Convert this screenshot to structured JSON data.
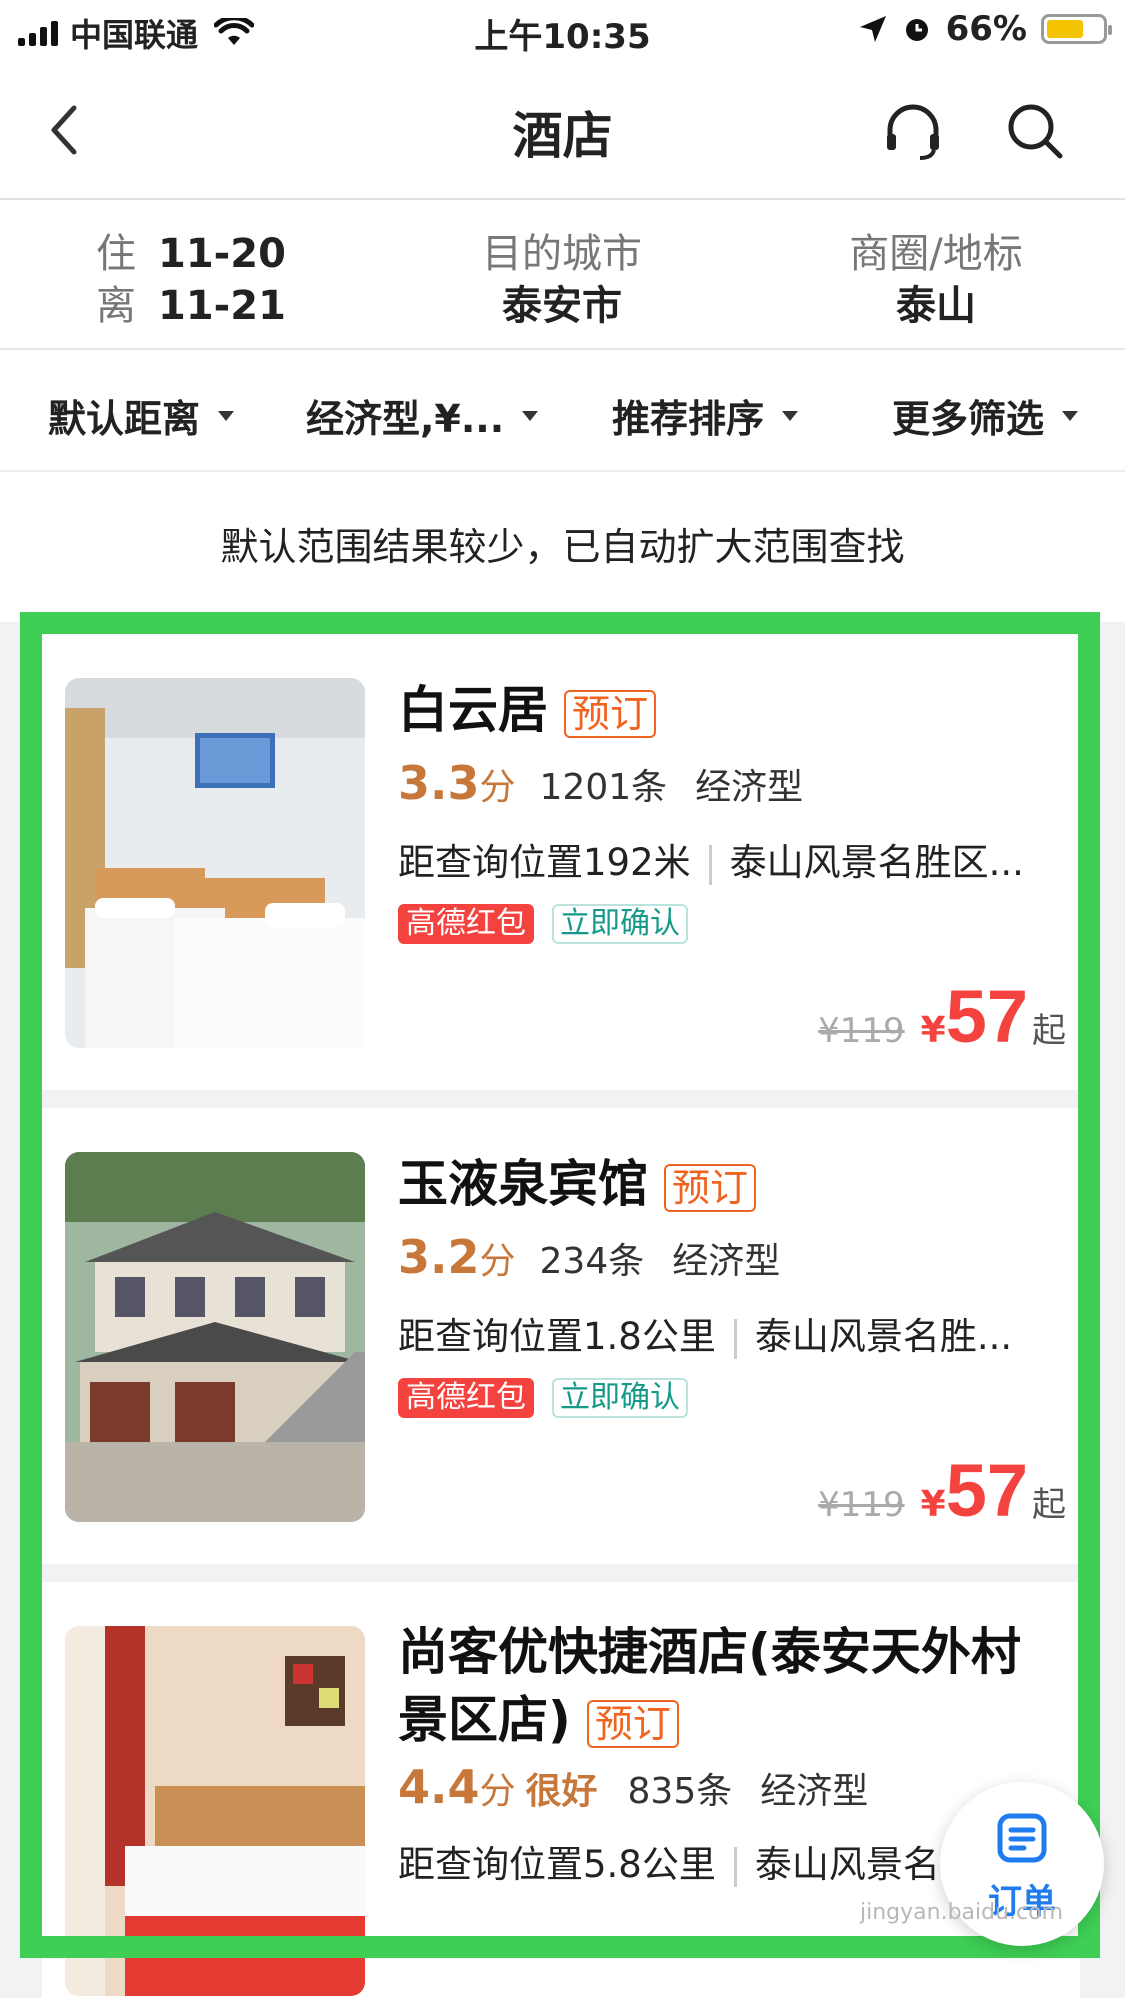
{
  "status_bar": {
    "carrier": "中国联通",
    "time": "上午10:35",
    "battery": "66%"
  },
  "nav": {
    "title": "酒店",
    "back_icon": "chevron-left-icon",
    "service_icon": "headset-icon",
    "search_icon": "search-icon"
  },
  "info": {
    "checkin_label": "住",
    "checkin_date": "11-20",
    "checkout_label": "离",
    "checkout_date": "11-21",
    "city_label": "目的城市",
    "city_value": "泰安市",
    "area_label": "商圈/地标",
    "area_value": "泰山"
  },
  "filters": [
    "默认距离",
    "经济型,¥...",
    "推荐排序",
    "更多筛选"
  ],
  "notice": "默认范围结果较少，已自动扩大范围查找",
  "hotels": [
    {
      "name": "白云居",
      "book_tag": "预订",
      "score": "3.3",
      "score_unit": "分",
      "reviews": "1201条",
      "category": "经济型",
      "distance": "距查询位置192米",
      "area": "泰山风景名胜区...",
      "tag1": "高德红包",
      "tag2": "立即确认",
      "orig_price": "¥119",
      "currency": "¥",
      "price": "57",
      "price_suffix": "起"
    },
    {
      "name": "玉液泉宾馆",
      "book_tag": "预订",
      "score": "3.2",
      "score_unit": "分",
      "reviews": "234条",
      "category": "经济型",
      "distance": "距查询位置1.8公里",
      "area": "泰山风景名胜...",
      "tag1": "高德红包",
      "tag2": "立即确认",
      "orig_price": "¥119",
      "currency": "¥",
      "price": "57",
      "price_suffix": "起"
    },
    {
      "name": "尚客优快捷酒店(泰安天外村景区店)",
      "book_tag": "预订",
      "score": "4.4",
      "score_unit": "分",
      "rating_word": "很好",
      "reviews": "835条",
      "category": "经济型",
      "distance": "距查询位置5.8公里",
      "area": "泰山风景名"
    }
  ],
  "fab": {
    "label": "订单",
    "icon": "order-list-icon"
  },
  "watermark": "jingyan.baidu.com",
  "colors": {
    "accent_green_frame": "#3ecf54",
    "score": "#c8773a",
    "price_red": "#f4433e",
    "book_orange": "#f06420",
    "confirm_teal": "#159a8a",
    "fab_blue": "#1e7bf0"
  }
}
